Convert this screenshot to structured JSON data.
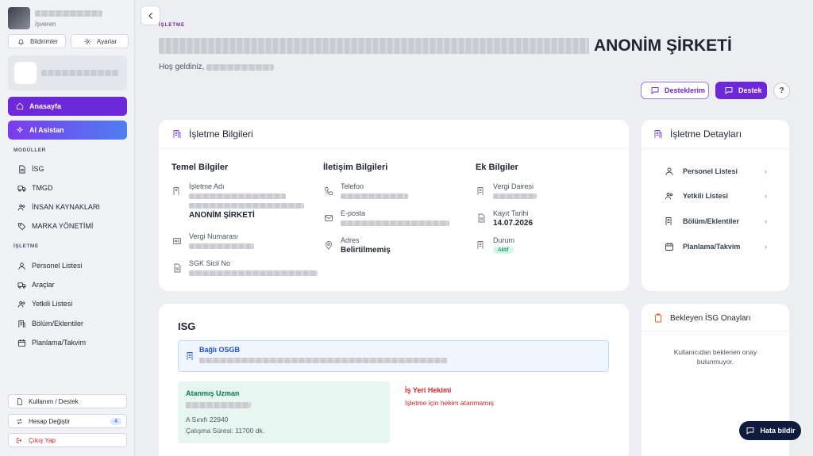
{
  "user": {
    "role": "İşveren"
  },
  "sidebar": {
    "notifications_label": "Bildirimler",
    "settings_label": "Ayarlar",
    "nav_home": "Anasayfa",
    "nav_ai": "AI Asistan",
    "modules_title": "MODÜLLER",
    "modules": [
      "İSG",
      "TMGD",
      "İNSAN KAYNAKLARI",
      "MARKA YÖNETİMİ"
    ],
    "business_title": "İŞLETME",
    "business_items": [
      "Personel Listesi",
      "Araçlar",
      "Yetkili Listesi",
      "Bölüm/Eklentiler",
      "Planlama/Takvim"
    ],
    "usage_label": "Kullanım / Destek",
    "switch_label": "Hesap Değiştir",
    "switch_count": "4",
    "logout_label": "Çıkış Yap"
  },
  "header": {
    "eyebrow": "İŞLETME",
    "title_suffix": "ANONİM ŞİRKETİ",
    "welcome": "Hoş geldiniz,",
    "my_support_label": "Desteklerim",
    "support_label": "Destek",
    "help_symbol": "?"
  },
  "info": {
    "title": "İşletme Bilgileri",
    "basic_title": "Temel Bilgiler",
    "name_label": "İşletme Adı",
    "name_suffix": "ANONİM ŞİRKETİ",
    "tax_no_label": "Vergi Numarası",
    "sgk_label": "SGK Sicil No",
    "contact_title": "İletişim Bilgileri",
    "phone_label": "Telefon",
    "email_label": "E-posta",
    "address_label": "Adres",
    "address_value": "Belirtilmemiş",
    "extra_title": "Ek Bilgiler",
    "tax_office_label": "Vergi Dairesi",
    "reg_date_label": "Kayıt Tarihi",
    "reg_date_value": "14.07.2026",
    "status_label": "Durum",
    "status_value": "Aktif"
  },
  "details": {
    "title": "İşletme Detayları",
    "items": [
      "Personel Listesi",
      "Yetkili Listesi",
      "Bölüm/Eklentiler",
      "Planlama/Takvim"
    ]
  },
  "isg": {
    "title": "ISG",
    "osgb_label": "Bağlı OSGB",
    "expert_label": "Atanmış Uzman",
    "expert_class": "A Sınıfı 22940",
    "expert_hours": "Çalışma Süresi: 11700 dk.",
    "doctor_label": "İş Yeri Hekimi",
    "doctor_missing": "İşletme için hekim atanmamış"
  },
  "pending": {
    "title": "Bekleyen İSG Onayları",
    "empty": "Kullanıcıdan beklenen onay bulunmuyor."
  },
  "report_bug": "Hata bildir"
}
